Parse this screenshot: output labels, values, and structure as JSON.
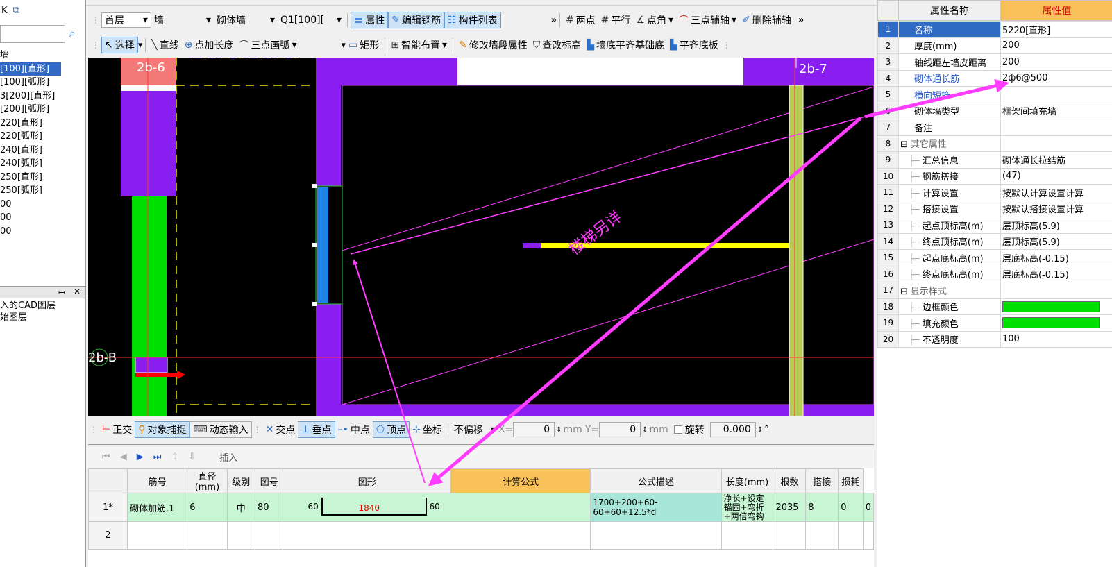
{
  "left_panel": {
    "toolbar_icon_a": "K",
    "tree_items": [
      "墙",
      "[100][直形]",
      "[100][弧形]",
      "3[200][直形]",
      "[200][弧形]",
      "220[直形]",
      "220[弧形]",
      "240[直形]",
      "240[弧形]",
      "250[直形]",
      "250[弧形]",
      "00",
      "00",
      "00"
    ],
    "pane2_items": [
      "入的CAD图层",
      "始图层"
    ],
    "pane2_pin": "ꟷ",
    "pane2_close": "✕"
  },
  "toolbar1": {
    "floor": "首层",
    "category": "墙",
    "type": "砌体墙",
    "component": "Q1[100][",
    "btn_props": "属性",
    "btn_edit_rebar": "编辑钢筋",
    "btn_list": "构件列表",
    "more": "»",
    "btn_two_point": "两点",
    "btn_parallel": "平行",
    "btn_point_angle": "点角",
    "btn_three_point_axis": "三点辅轴",
    "btn_delete_axis": "删除辅轴"
  },
  "toolbar2": {
    "btn_select": "选择",
    "btn_line": "直线",
    "btn_point_length": "点加长度",
    "btn_arc": "三点画弧",
    "btn_rect": "矩形",
    "btn_smart": "智能布置",
    "btn_modify_segment": "修改墙段属性",
    "btn_check_elev": "查改标高",
    "btn_wall_align": "墙底平齐基础底",
    "btn_align_slab": "平齐底板"
  },
  "canvas": {
    "label_2b6": "2b-6",
    "label_2b7": "2b-7",
    "label_2bB": "2b-B",
    "stair_note": "楼梯另详"
  },
  "snapbar": {
    "btn_ortho": "正交",
    "btn_snap": "对象捕捉",
    "btn_dynamic": "动态输入",
    "btn_intersect": "交点",
    "btn_perp": "垂点",
    "btn_mid": "中点",
    "btn_vertex": "顶点",
    "btn_coord": "坐标",
    "offset_mode": "不偏移",
    "x_label": "X=",
    "x_value": "0",
    "unit_mm": "mm",
    "y_label": "Y=",
    "y_value": "0",
    "rotate_label": "旋转",
    "rotate_value": "0.000",
    "degree": "°"
  },
  "rebar_panel": {
    "insert_label": "插入",
    "headers": [
      "筋号",
      "直径(mm)",
      "级别",
      "图号",
      "图形",
      "计算公式",
      "公式描述",
      "长度(mm)",
      "根数",
      "搭接",
      "损耗"
    ],
    "rows": [
      {
        "num": "1*",
        "name": "砌体加筋.1",
        "diameter": "6",
        "grade": "中",
        "fig": "80",
        "shape_left": "60",
        "shape_mid": "1840",
        "shape_right": "60",
        "formula": "1700+200+60-60+60+12.5*d",
        "desc": "净长+设定锚固+弯折+两倍弯钩",
        "length": "2035",
        "count": "8",
        "lap": "0",
        "loss": "0"
      },
      {
        "num": "2"
      }
    ]
  },
  "props_panel": {
    "header_name": "属性名称",
    "header_value": "属性值",
    "rows": [
      {
        "idx": "1",
        "name": "名称",
        "value": "5220[直形]",
        "style": "sel"
      },
      {
        "idx": "2",
        "name": "厚度(mm)",
        "value": "200"
      },
      {
        "idx": "3",
        "name": "轴线距左墙皮距离",
        "value": "200"
      },
      {
        "idx": "4",
        "name": "砌体通长筋",
        "value": "2ф6@500",
        "style": "blue"
      },
      {
        "idx": "5",
        "name": "横向短筋",
        "value": "",
        "style": "blue"
      },
      {
        "idx": "6",
        "name": "砌体墙类型",
        "value": "框架间填充墙"
      },
      {
        "idx": "7",
        "name": "备注",
        "value": ""
      },
      {
        "idx": "8",
        "name": "其它属性",
        "value": "",
        "style": "group"
      },
      {
        "idx": "9",
        "name": "汇总信息",
        "value": "砌体通长拉结筋",
        "style": "child"
      },
      {
        "idx": "10",
        "name": "钢筋搭接",
        "value": "(47)",
        "style": "child"
      },
      {
        "idx": "11",
        "name": "计算设置",
        "value": "按默认计算设置计算",
        "style": "child"
      },
      {
        "idx": "12",
        "name": "搭接设置",
        "value": "按默认搭接设置计算",
        "style": "child"
      },
      {
        "idx": "13",
        "name": "起点顶标高(m)",
        "value": "层顶标高(5.9)",
        "style": "child"
      },
      {
        "idx": "14",
        "name": "终点顶标高(m)",
        "value": "层顶标高(5.9)",
        "style": "child"
      },
      {
        "idx": "15",
        "name": "起点底标高(m)",
        "value": "层底标高(-0.15)",
        "style": "child"
      },
      {
        "idx": "16",
        "name": "终点底标高(m)",
        "value": "层底标高(-0.15)",
        "style": "child"
      },
      {
        "idx": "17",
        "name": "显示样式",
        "value": "",
        "style": "group"
      },
      {
        "idx": "18",
        "name": "边框颜色",
        "value": "",
        "style": "child swatch"
      },
      {
        "idx": "19",
        "name": "填充颜色",
        "value": "",
        "style": "child swatch"
      },
      {
        "idx": "20",
        "name": "不透明度",
        "value": "100",
        "style": "child"
      }
    ]
  },
  "colors": {
    "purple": "#8a1ef0",
    "green": "#00e000",
    "yellow": "#ffff00",
    "magenta": "#ff3cff",
    "blue_bar": "#1e82e6",
    "salmon": "#f47a7a",
    "selection": "#316ac5",
    "header_orange": "#f8c15a"
  }
}
